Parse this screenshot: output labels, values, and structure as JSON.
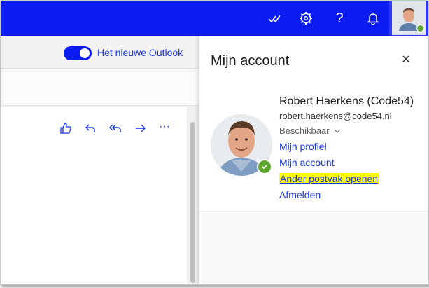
{
  "topbar": {
    "icons": [
      "todo-check-icon",
      "gear-icon",
      "help-icon",
      "bell-icon"
    ],
    "help_glyph": "?",
    "brand_color": "#0b1cf2"
  },
  "left": {
    "toggle_label": "Het nieuwe Outlook",
    "toggle_on": true,
    "actions": [
      "like-icon",
      "reply-icon",
      "reply-all-icon",
      "forward-icon",
      "more-icon"
    ],
    "more_glyph": "···"
  },
  "panel": {
    "title": "Mijn account",
    "close_glyph": "✕",
    "user": {
      "name": "Robert Haerkens (Code54)",
      "email": "robert.haerkens@code54.nl",
      "presence": "Beschikbaar",
      "presence_color": "#5fa631"
    },
    "links": {
      "profile": "Mijn profiel",
      "account": "Mijn account",
      "open_mailbox": "Ander postvak openen",
      "signout": "Afmelden"
    }
  }
}
